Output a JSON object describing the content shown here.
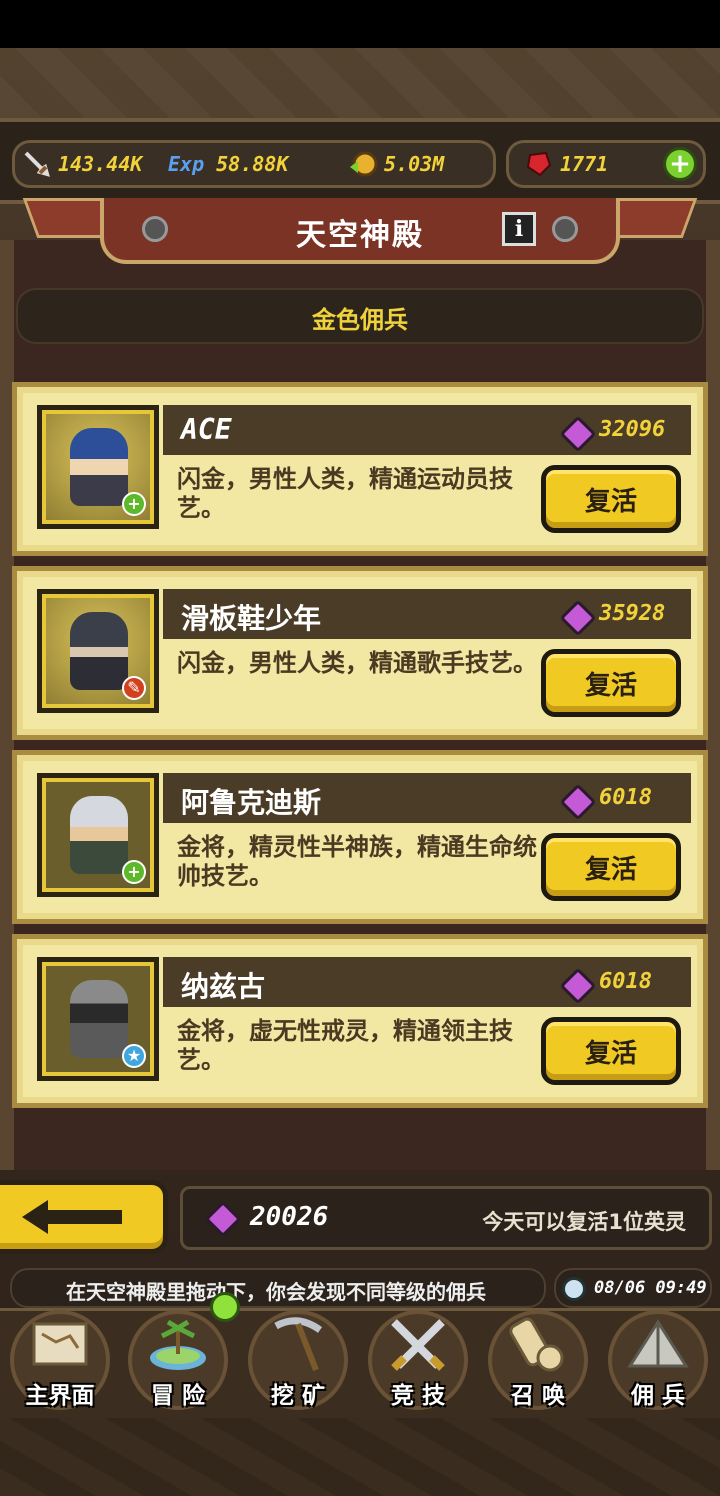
{
  "resources": {
    "attack": "143.44K",
    "exp_label": "Exp",
    "exp": "58.88K",
    "gold": "5.03M",
    "gems": "1771",
    "add_label": "+"
  },
  "header": {
    "title": "天空神殿",
    "info_label": "i"
  },
  "section": {
    "title": "金色佣兵"
  },
  "heroes": [
    {
      "name": "ACE",
      "cost": "32096",
      "desc": "闪金，男性人类，精通运动员技艺。",
      "action": "复活",
      "badge": "+"
    },
    {
      "name": "滑板鞋少年",
      "cost": "35928",
      "desc": "闪金，男性人类，精通歌手技艺。",
      "action": "复活",
      "badge": "✎"
    },
    {
      "name": "阿鲁克迪斯",
      "cost": "6018",
      "desc": "金将，精灵性半神族，精通生命统帅技艺。",
      "action": "复活",
      "badge": "+"
    },
    {
      "name": "纳兹古",
      "cost": "6018",
      "desc": "金将，虚无性戒灵，精通领主技艺。",
      "action": "复活",
      "badge": "★"
    }
  ],
  "footer": {
    "gem_total": "20026",
    "revive_note": "今天可以复活1位英灵"
  },
  "ticker": {
    "text": "在天空神殿里拖动下，你会发现不同等级的佣兵",
    "time": "08/06 09:49"
  },
  "nav": [
    {
      "label": "主界面"
    },
    {
      "label": "冒 险"
    },
    {
      "label": "挖 矿"
    },
    {
      "label": "竞 技"
    },
    {
      "label": "召 唤"
    },
    {
      "label": "佣 兵"
    }
  ],
  "colors": {
    "accent_gold": "#f2d23a",
    "button_yellow": "#f0c923",
    "card_bg": "#f3e7a4",
    "gem_purple": "#c55ad6"
  }
}
